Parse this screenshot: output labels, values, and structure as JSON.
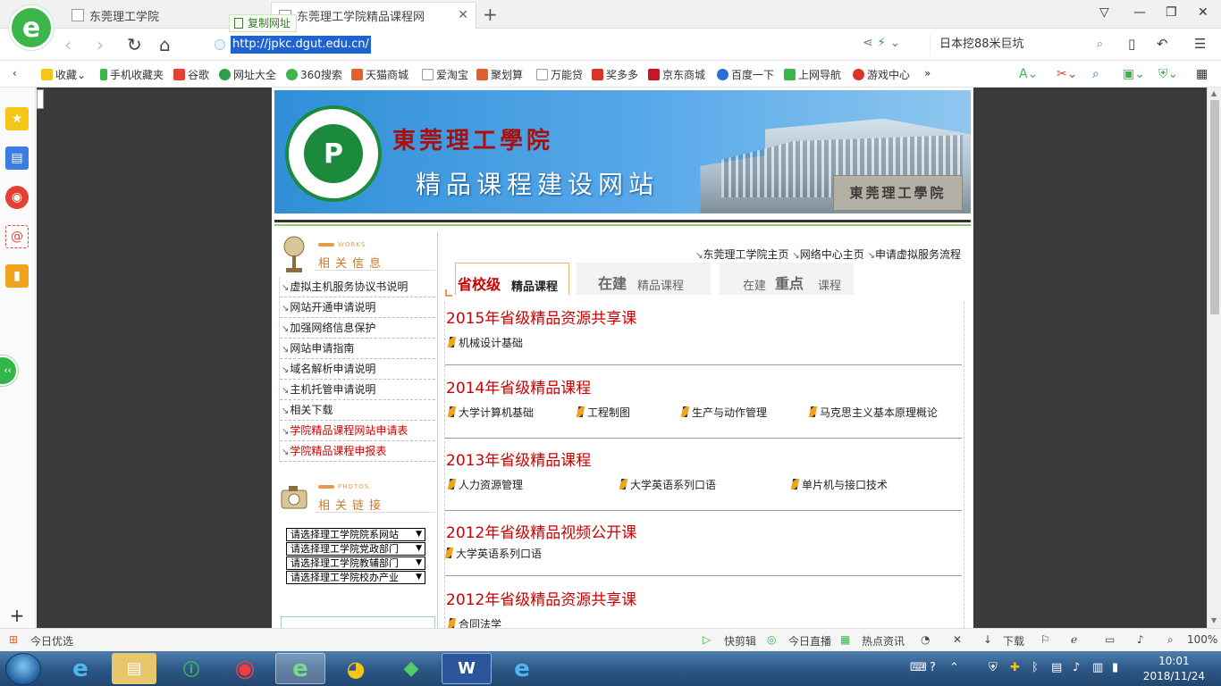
{
  "browser": {
    "tabs": [
      {
        "title": "东莞理工学院"
      },
      {
        "title": "东莞理工学院精品课程网"
      }
    ],
    "copy_url_label": "复制网址",
    "url": "http://jpkc.dgut.edu.cn/",
    "search_text": "日本挖88米巨坑",
    "bookmarks": [
      "收藏",
      "手机收藏夹",
      "谷歌",
      "网址大全",
      "360搜索",
      "天猫商城",
      "爱淘宝",
      "聚划算",
      "万能贷",
      "奖多多",
      "京东商城",
      "百度一下",
      "上网导航",
      "游戏中心"
    ],
    "status_left": "今日优选",
    "status_items": [
      "快剪辑",
      "今日直播",
      "热点资讯",
      "下载",
      "100%"
    ]
  },
  "site": {
    "school_name": "東莞理工學院",
    "site_name": "精品课程建设网站",
    "stone_text": "東莞理工學院",
    "emblem_text": "DONGGUAN UNIVERSITY OF TECHNOLOGY",
    "sec1_tag": "WORKS",
    "sec1_title": "相关信息",
    "info_links": [
      {
        "label": "虚拟主机服务协议书说明"
      },
      {
        "label": "网站开通申请说明"
      },
      {
        "label": "加强网络信息保护"
      },
      {
        "label": "网站申请指南"
      },
      {
        "label": "域名解析申请说明"
      },
      {
        "label": "主机托管申请说明"
      },
      {
        "label": "相关下载"
      },
      {
        "label": "学院精品课程网站申请表"
      },
      {
        "label": "学院精品课程申报表"
      }
    ],
    "sec2_tag": "PHOTOS",
    "sec2_title": "相关链接",
    "selects": [
      "请选择理工学院院系网站",
      "请选择理工学院党政部门",
      "请选择理工学院教辅部门",
      "请选择理工学院校办产业"
    ],
    "top_links": [
      "东莞理工学院主页",
      "网络中心主页",
      "申请虚拟服务流程"
    ],
    "tabs": {
      "t1_big": "省校级",
      "t1_small": "精品课程",
      "t2_big": "在建",
      "t2_small": "精品课程",
      "t3_s1": "在建",
      "t3_big": "重点",
      "t3_s2": "课程"
    },
    "categories": [
      {
        "title": "2015年省级精品资源共享课",
        "items": [
          "机械设计基础"
        ]
      },
      {
        "title": "2014年省级精品课程",
        "items": [
          "大学计算机基础",
          "工程制图",
          "生产与动作管理",
          "马克思主义基本原理概论"
        ]
      },
      {
        "title": "2013年省级精品课程",
        "items": [
          "人力资源管理",
          "大学英语系列口语",
          "单片机与接口技术"
        ]
      },
      {
        "title": "2012年省级精品视频公开课",
        "items": [
          "大学英语系列口语"
        ]
      },
      {
        "title": "2012年省级精品资源共享课",
        "items": [
          "合同法学"
        ]
      }
    ]
  },
  "taskbar": {
    "time": "10:01",
    "date": "2018/11/24"
  }
}
